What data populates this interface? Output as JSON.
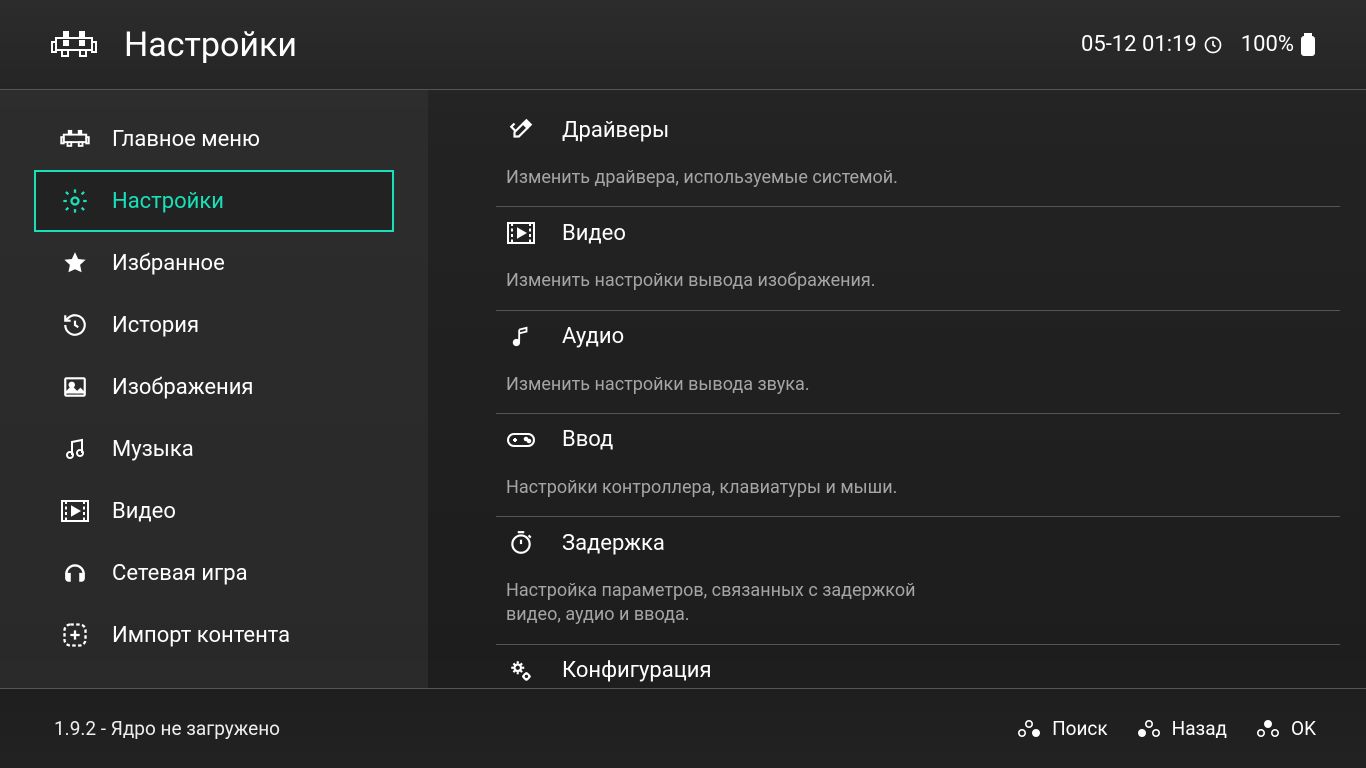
{
  "header": {
    "title": "Настройки",
    "datetime": "05-12 01:19",
    "battery": "100%"
  },
  "sidebar": {
    "items": [
      {
        "label": "Главное меню",
        "icon": "invader-icon"
      },
      {
        "label": "Настройки",
        "icon": "gear-icon",
        "selected": true
      },
      {
        "label": "Избранное",
        "icon": "star-icon"
      },
      {
        "label": "История",
        "icon": "history-icon"
      },
      {
        "label": "Изображения",
        "icon": "image-icon"
      },
      {
        "label": "Музыка",
        "icon": "music-icon"
      },
      {
        "label": "Видео",
        "icon": "video-icon"
      },
      {
        "label": "Сетевая игра",
        "icon": "headset-icon"
      },
      {
        "label": "Импорт контента",
        "icon": "plus-box-icon"
      }
    ]
  },
  "main": {
    "items": [
      {
        "label": "Драйверы",
        "desc": "Изменить драйвера, используемые системой.",
        "icon": "tools-icon"
      },
      {
        "label": "Видео",
        "desc": "Изменить настройки вывода изображения.",
        "icon": "video-icon"
      },
      {
        "label": "Аудио",
        "desc": "Изменить настройки вывода звука.",
        "icon": "music-icon"
      },
      {
        "label": "Ввод",
        "desc": "Настройки контроллера, клавиатуры и мыши.",
        "icon": "gamepad-icon"
      },
      {
        "label": "Задержка",
        "desc": "Настройка параметров, связанных с задержкой видео, аудио и ввода.",
        "icon": "timer-icon"
      },
      {
        "label": "Конфигурация",
        "desc": "",
        "icon": "gear-small-icon"
      }
    ]
  },
  "footer": {
    "status": "1.9.2 - Ядро не загружено",
    "hints": [
      {
        "label": "Поиск"
      },
      {
        "label": "Назад"
      },
      {
        "label": "OK"
      }
    ]
  }
}
